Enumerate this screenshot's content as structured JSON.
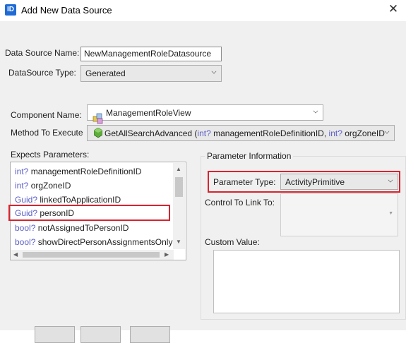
{
  "window": {
    "title": "Add New Data Source",
    "app_icon": "ID"
  },
  "form": {
    "data_source_name_label": "Data Source Name:",
    "data_source_name_value": "NewManagementRoleDatasource",
    "datasource_type_label": "DataSource Type:",
    "datasource_type_value": "Generated",
    "component_name_label": "Component Name:",
    "component_name_value": "ManagementRoleView",
    "method_label": "Method To Execute",
    "method": {
      "name": "GetAllSearchAdvanced (",
      "t1": "int?",
      "p1": " managementRoleDefinitionID, ",
      "t2": "int?",
      "p2": " orgZoneID"
    }
  },
  "parameters": {
    "label": "Expects Parameters:",
    "items": [
      {
        "type": "int?",
        "name": "managementRoleDefinitionID"
      },
      {
        "type": "int?",
        "name": "orgZoneID"
      },
      {
        "type": "Guid?",
        "name": "linkedToApplicationID"
      },
      {
        "type": "Guid?",
        "name": "personID"
      },
      {
        "type": "bool?",
        "name": "notAssignedToPersonID"
      },
      {
        "type": "bool?",
        "name": "showDirectPersonAssignmentsOnly"
      }
    ],
    "selected_index": 3
  },
  "parameter_info": {
    "group_title": "Parameter Information",
    "type_label": "Parameter Type:",
    "type_value": "ActivityPrimitive",
    "control_label": "Control To Link To:",
    "control_value": "",
    "custom_value_label": "Custom Value:",
    "custom_value": ""
  },
  "colors": {
    "highlight": "#d9232e",
    "keyword": "#5b5fc7"
  }
}
